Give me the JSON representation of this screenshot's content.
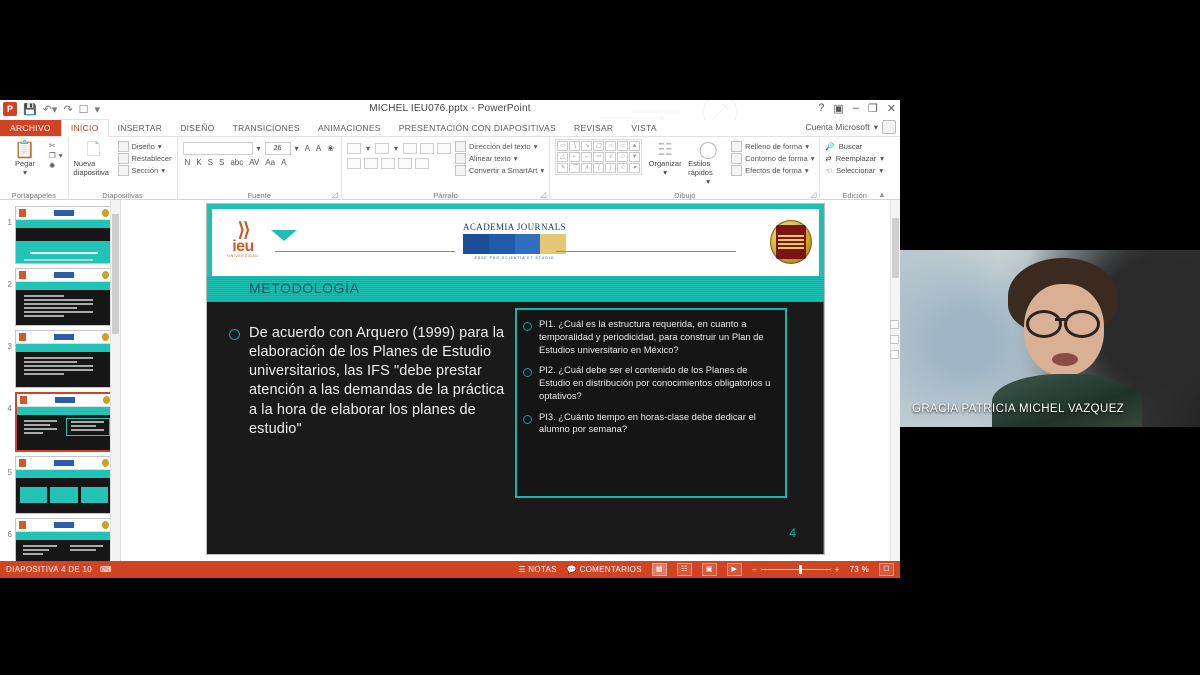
{
  "window": {
    "title": "MICHEL IEU076.pptx - PowerPoint",
    "account": "Cuenta Microsoft",
    "quick_access": [
      "save-icon",
      "undo-icon",
      "redo-icon",
      "presentation-icon",
      "customize-icon"
    ],
    "buttons": {
      "help": "?",
      "ribbon_options": "▣",
      "minimize": "–",
      "restore": "❐",
      "close": "✕"
    }
  },
  "ribbon": {
    "tabs": [
      {
        "label": "ARCHIVO",
        "type": "file"
      },
      {
        "label": "INICIO",
        "type": "active"
      },
      {
        "label": "INSERTAR",
        "type": "normal"
      },
      {
        "label": "DISEÑO",
        "type": "normal"
      },
      {
        "label": "TRANSICIONES",
        "type": "normal"
      },
      {
        "label": "ANIMACIONES",
        "type": "normal"
      },
      {
        "label": "PRESENTACIÓN CON DIAPOSITIVAS",
        "type": "normal"
      },
      {
        "label": "REVISAR",
        "type": "normal"
      },
      {
        "label": "VISTA",
        "type": "normal"
      }
    ],
    "groups": {
      "clipboard": {
        "label": "Portapapeles",
        "paste": "Pegar",
        "cut": "Cortar",
        "copy": "Copiar",
        "format_painter": "Copiar formato"
      },
      "slides": {
        "label": "Diapositivas",
        "new_slide": "Nueva diapositiva",
        "layout": "Diseño",
        "reset": "Restablecer",
        "section": "Sección"
      },
      "font": {
        "label": "Fuente",
        "font_name": "",
        "font_size": "26",
        "grow": "A",
        "shrink": "A",
        "clear_format": "Borrar formato",
        "bold": "N",
        "italic": "K",
        "underline": "S",
        "shadow": "S",
        "strike": "abc",
        "spacing": "AV",
        "case": "Aa",
        "color": "A"
      },
      "paragraph": {
        "label": "Párrafo",
        "text_direction": "Dirección del texto",
        "align_text": "Alinear texto",
        "smartart": "Convertir a SmartArt"
      },
      "drawing": {
        "label": "Dibujo",
        "arrange": "Organizar",
        "quick_styles": "Estilos rápidos",
        "shape_fill": "Relleno de forma",
        "shape_outline": "Contorno de forma",
        "shape_effects": "Efectos de forma"
      },
      "editing": {
        "label": "Edición",
        "find": "Buscar",
        "replace": "Reemplazar",
        "select": "Seleccionar"
      }
    }
  },
  "thumbnails": [
    {
      "number": "1",
      "selected": false,
      "kind": "title"
    },
    {
      "number": "2",
      "selected": false,
      "kind": "text"
    },
    {
      "number": "3",
      "selected": false,
      "kind": "text"
    },
    {
      "number": "4",
      "selected": true,
      "kind": "two-col"
    },
    {
      "number": "5",
      "selected": false,
      "kind": "arrows"
    },
    {
      "number": "6",
      "selected": false,
      "kind": "two-col"
    }
  ],
  "slide": {
    "logo_ieu": {
      "word": "ieu",
      "sub": "UNIVERSIDAD"
    },
    "logo_aj": {
      "title": "ACADEMIA JOURNALS",
      "footer": "ESSE PRO SCIENTIA ET STUDIO"
    },
    "seal_name": "gold-seal-icon",
    "section_title": "METODOLOGÍA",
    "left_bullet": "De acuerdo con Arquero (1999) para la elaboración de los Planes de Estudio universitarios, las IFS \"debe prestar atención a las demandas de la práctica a la hora de elaborar los planes de estudio\"",
    "questions": [
      "PI1. ¿Cuál es la estructura requerida, en cuanto a temporalidad y periodicidad, para construir un Plan de Estudios universitario en México?",
      "PI2. ¿Cuál debe ser el contenido de los Planes de Estudio en distribución por conocimientos obligatorios u optativos?",
      "PI3. ¿Cuánto tiempo en horas-clase debe dedicar el alumno por semana?"
    ],
    "slide_number": "4",
    "accent_color": "#1fbfb4",
    "background_color": "#1a1a1a"
  },
  "status_bar": {
    "slide_counter": "DIAPOSITIVA 4 DE 10",
    "language_icon": "language-icon",
    "notes": "NOTAS",
    "comments": "COMENTARIOS",
    "views": [
      "normal-view-icon",
      "slide-sorter-icon",
      "reading-view-icon",
      "slideshow-icon"
    ],
    "zoom_out": "–",
    "zoom_in": "+",
    "zoom_level": "73 %",
    "fit_to_window": "fit-icon",
    "accent_color": "#d04423"
  },
  "webcam": {
    "participant_name": "GRACIA PATRICIA MICHEL VAZQUEZ"
  }
}
